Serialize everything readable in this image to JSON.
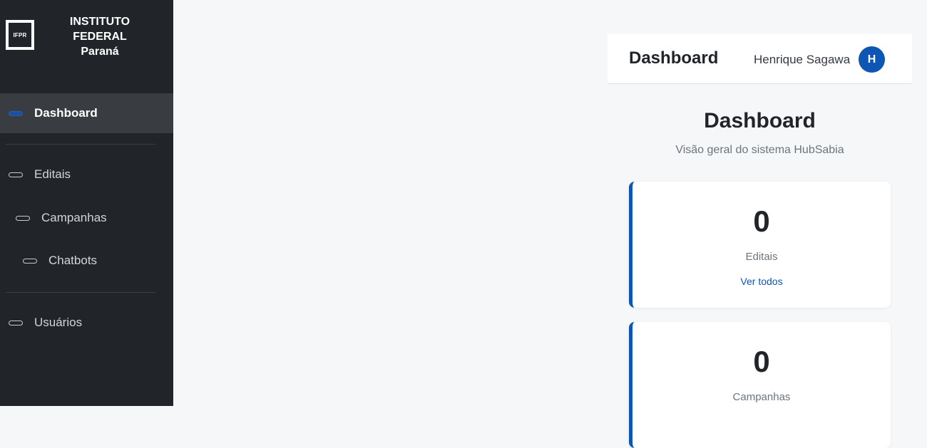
{
  "brand": {
    "logo_text": "IFPR",
    "name_line1": "INSTITUTO",
    "name_line2": "FEDERAL",
    "name_line3": "Paraná"
  },
  "sidebar": {
    "items": [
      {
        "label": "Dashboard",
        "icon": "pill-icon",
        "active": true
      },
      {
        "label": "Editais",
        "icon": "pill-icon"
      },
      {
        "label": "Campanhas",
        "icon": "pill-icon"
      },
      {
        "label": "Chatbots",
        "icon": "pill-icon"
      },
      {
        "label": "Usuários",
        "icon": "pill-icon"
      }
    ]
  },
  "header": {
    "title": "Dashboard",
    "user_name": "Henrique Sagawa",
    "avatar_initial": "H"
  },
  "main": {
    "title": "Dashboard",
    "subtitle": "Visão geral do sistema HubSabia",
    "cards": [
      {
        "value": "0",
        "label": "Editais",
        "link": "Ver todos"
      },
      {
        "value": "0",
        "label": "Campanhas"
      }
    ]
  },
  "colors": {
    "sidebar_bg": "#212429",
    "active_bg": "#393c41",
    "accent": "#0d56b3",
    "page_bg": "#f6f7f9"
  }
}
